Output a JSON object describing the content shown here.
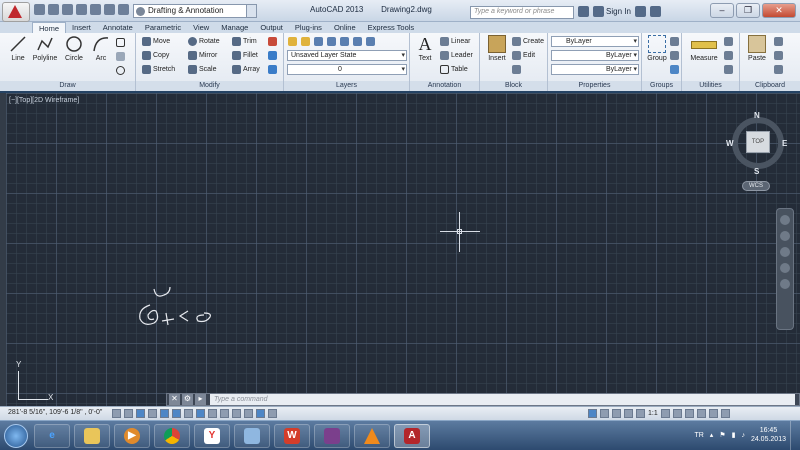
{
  "titlebar": {
    "workspace": "Drafting & Annotation",
    "app_title": "AutoCAD 2013",
    "document_title": "Drawing2.dwg",
    "search_placeholder": "Type a keyword or phrase",
    "sign_in": "Sign In",
    "help": "?",
    "minimize": "–",
    "restore": "❐",
    "close": "✕"
  },
  "tabs": [
    "Home",
    "Insert",
    "Annotate",
    "Parametric",
    "View",
    "Manage",
    "Output",
    "Plug-ins",
    "Online",
    "Express Tools"
  ],
  "ribbon": {
    "draw": {
      "title": "Draw",
      "line": "Line",
      "polyline": "Polyline",
      "circle": "Circle",
      "arc": "Arc"
    },
    "modify": {
      "title": "Modify",
      "move": "Move",
      "rotate": "Rotate",
      "trim": "Trim",
      "copy": "Copy",
      "mirror": "Mirror",
      "fillet": "Fillet",
      "stretch": "Stretch",
      "scale": "Scale",
      "array": "Array"
    },
    "layers": {
      "title": "Layers",
      "layer_state": "Unsaved Layer State",
      "current_layer": "0"
    },
    "annotation": {
      "title": "Annotation",
      "text": "Text",
      "linear": "Linear",
      "leader": "Leader",
      "table": "Table"
    },
    "block": {
      "title": "Block",
      "insert": "Insert",
      "create": "Create",
      "edit": "Edit"
    },
    "properties": {
      "title": "Properties",
      "color": "ByLayer",
      "linetype": "ByLayer",
      "lineweight": "ByLayer"
    },
    "groups": {
      "title": "Groups",
      "group": "Group"
    },
    "utilities": {
      "title": "Utilities",
      "measure": "Measure"
    },
    "clipboard": {
      "title": "Clipboard",
      "paste": "Paste"
    }
  },
  "viewport": {
    "label": "[−][Top][2D Wireframe]",
    "viewcube": {
      "top": "TOP",
      "n": "N",
      "s": "S",
      "e": "E",
      "w": "W"
    },
    "wcs": "WCS",
    "ucs_x": "X",
    "ucs_y": "Y"
  },
  "command": {
    "placeholder": "Type a command"
  },
  "statusbar": {
    "coords": "281'-8 5/16\", 109'-6 1/8\" , 0'-0\"",
    "scale": "1:1"
  },
  "taskbar": {
    "language": "TR",
    "time": "16:45",
    "date": "24.05.2013"
  }
}
